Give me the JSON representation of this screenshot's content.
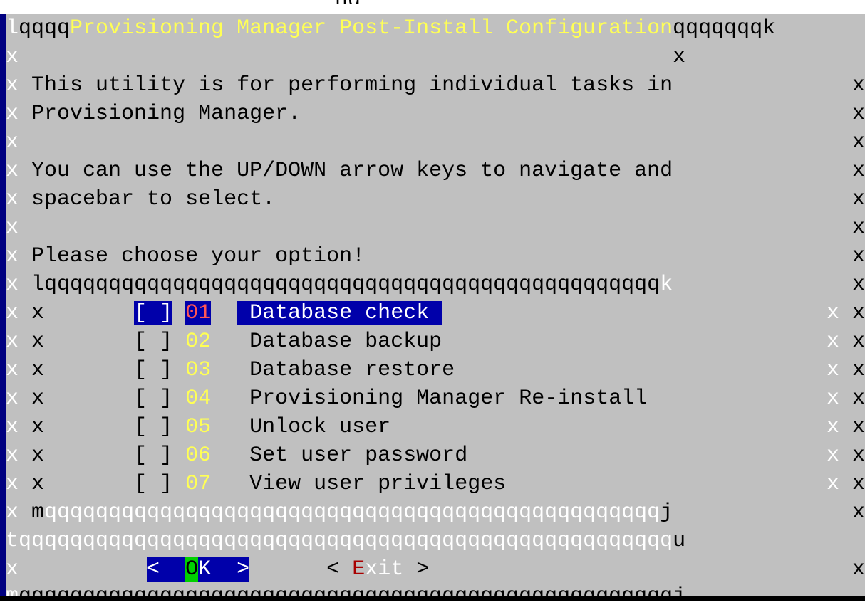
{
  "window": {
    "title_fragment": "ng"
  },
  "dialog": {
    "title": "Provisioning Manager Post-Install Configuration",
    "intro_line_1": "This utility is for performing individual tasks in",
    "intro_line_2": "Provisioning Manager.",
    "help_line_1": "You can use the UP/DOWN arrow keys to navigate and",
    "help_line_2": "spacebar to select.",
    "prompt": "Please choose your option!"
  },
  "options": [
    {
      "checkbox": "[ ]",
      "number": "01",
      "label": "Database check",
      "selected": true
    },
    {
      "checkbox": "[ ]",
      "number": "02",
      "label": "Database backup",
      "selected": false
    },
    {
      "checkbox": "[ ]",
      "number": "03",
      "label": "Database restore",
      "selected": false
    },
    {
      "checkbox": "[ ]",
      "number": "04",
      "label": "Provisioning Manager Re-install",
      "selected": false
    },
    {
      "checkbox": "[ ]",
      "number": "05",
      "label": "Unlock user",
      "selected": false
    },
    {
      "checkbox": "[ ]",
      "number": "06",
      "label": "Set user password",
      "selected": false
    },
    {
      "checkbox": "[ ]",
      "number": "07",
      "label": "View user privileges",
      "selected": false
    }
  ],
  "buttons": {
    "ok": {
      "open": "<",
      "hotkey": "O",
      "rest": "K",
      "close": ">",
      "selected": true
    },
    "exit": {
      "open": "<",
      "hotkey": "E",
      "rest": "xit",
      "close": ">",
      "selected": false
    }
  },
  "border": {
    "top_left": "l",
    "top_right": "k",
    "top_left_run": "qqqq",
    "top_right_run": "qqqqqqq",
    "side": "x",
    "list_top_left": "l",
    "list_top_run": "qqqqqqqqqqqqqqqqqqqqqqqqqqqqqqqqqqqqqqqqqqqqqqqq",
    "list_top_right": "k",
    "list_bottom_left": "m",
    "list_bottom_run": "qqqqqqqqqqqqqqqqqqqqqqqqqqqqqqqqqqqqqqqqqqqqqqqq",
    "list_bottom_right": "j",
    "sep_left": "t",
    "sep_run": "qqqqqqqqqqqqqqqqqqqqqqqqqqqqqqqqqqqqqqqqqqqqqqqqqqq",
    "sep_right": "u",
    "bottom_left": "m",
    "bottom_run": "qqqqqqqqqqqqqqqqqqqqqqqqqqqqqqqqqqqqqqqqqqqqqqqqqqq",
    "bottom_right": "j"
  },
  "colors": {
    "dialog_bg": "#c0c0c0",
    "title_text": "#ffff55",
    "highlight_bg": "#0000aa",
    "hotkey_bg": "#00d000",
    "hotkey_red": "#a80000",
    "number_yellow": "#ffff55"
  }
}
